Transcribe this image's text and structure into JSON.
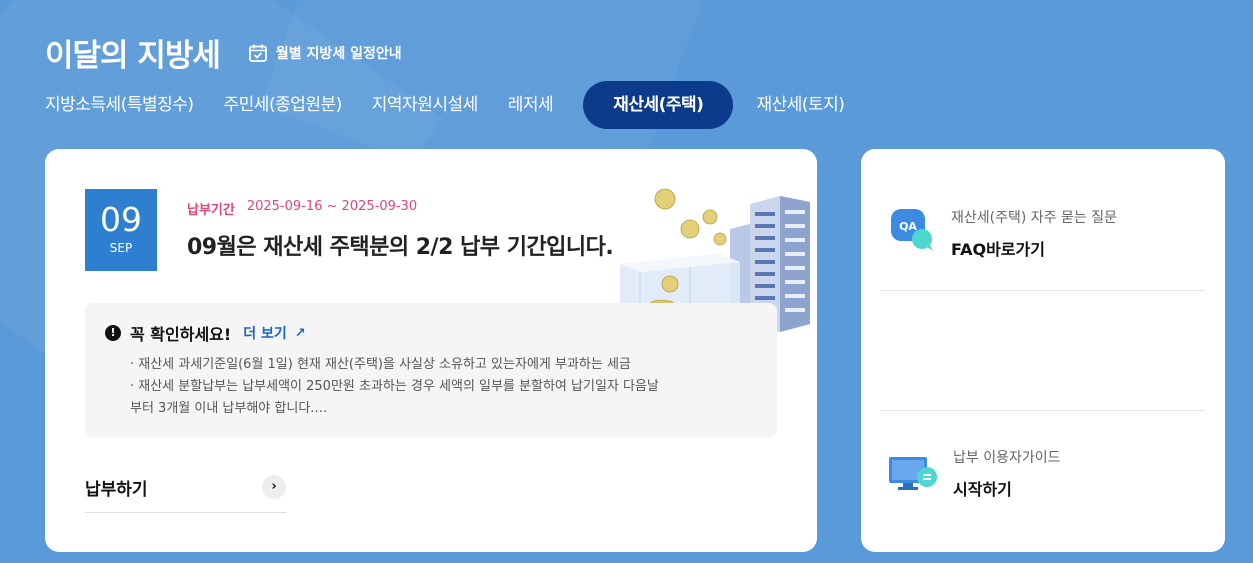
{
  "header": {
    "title": "이달의 지방세",
    "schedule_label": "월별 지방세 일정안내"
  },
  "tabs": [
    {
      "label": "지방소득세(특별징수)",
      "active": false
    },
    {
      "label": "주민세(종업원분)",
      "active": false
    },
    {
      "label": "지역자원시설세",
      "active": false
    },
    {
      "label": "레저세",
      "active": false
    },
    {
      "label": "재산세(주택)",
      "active": true
    },
    {
      "label": "재산세(토지)",
      "active": false
    }
  ],
  "main": {
    "date_day": "09",
    "date_month": "SEP",
    "period_label": "납부기간",
    "period_dates": "2025-09-16 ~ 2025-09-30",
    "headline": "09월은 재산세 주택분의 2/2 납부 기간입니다.",
    "notice": {
      "icon": "!",
      "title": "꼭 확인하세요!",
      "more_label": "더 보기",
      "more_arrow": "↗",
      "line1": "· 재산세 과세기준일(6월 1일) 현재 재산(주택)을 사실상 소유하고 있는자에게 부과하는 세금",
      "line2": "· 재산세 분할납부는 납부세액이 250만원 초과하는 경우 세액의 일부를 분할하여 납기일자 다음날",
      "line3": "부터 3개월 이내 납부해야 합니다.…"
    },
    "pay_label": "납부하기",
    "pay_arrow": "›"
  },
  "side": {
    "faq_icon_text": "QA",
    "faq_sub": "재산세(주택) 자주 묻는 질문",
    "faq_main": "FAQ바로가기",
    "guide_sub": "납부 이용자가이드",
    "guide_main": "시작하기"
  },
  "colors": {
    "background": "#5a9ad8",
    "active_tab": "#0d3b8c",
    "date_box": "#2f7fd0",
    "period": "#e0457b",
    "link": "#1b64c8"
  }
}
